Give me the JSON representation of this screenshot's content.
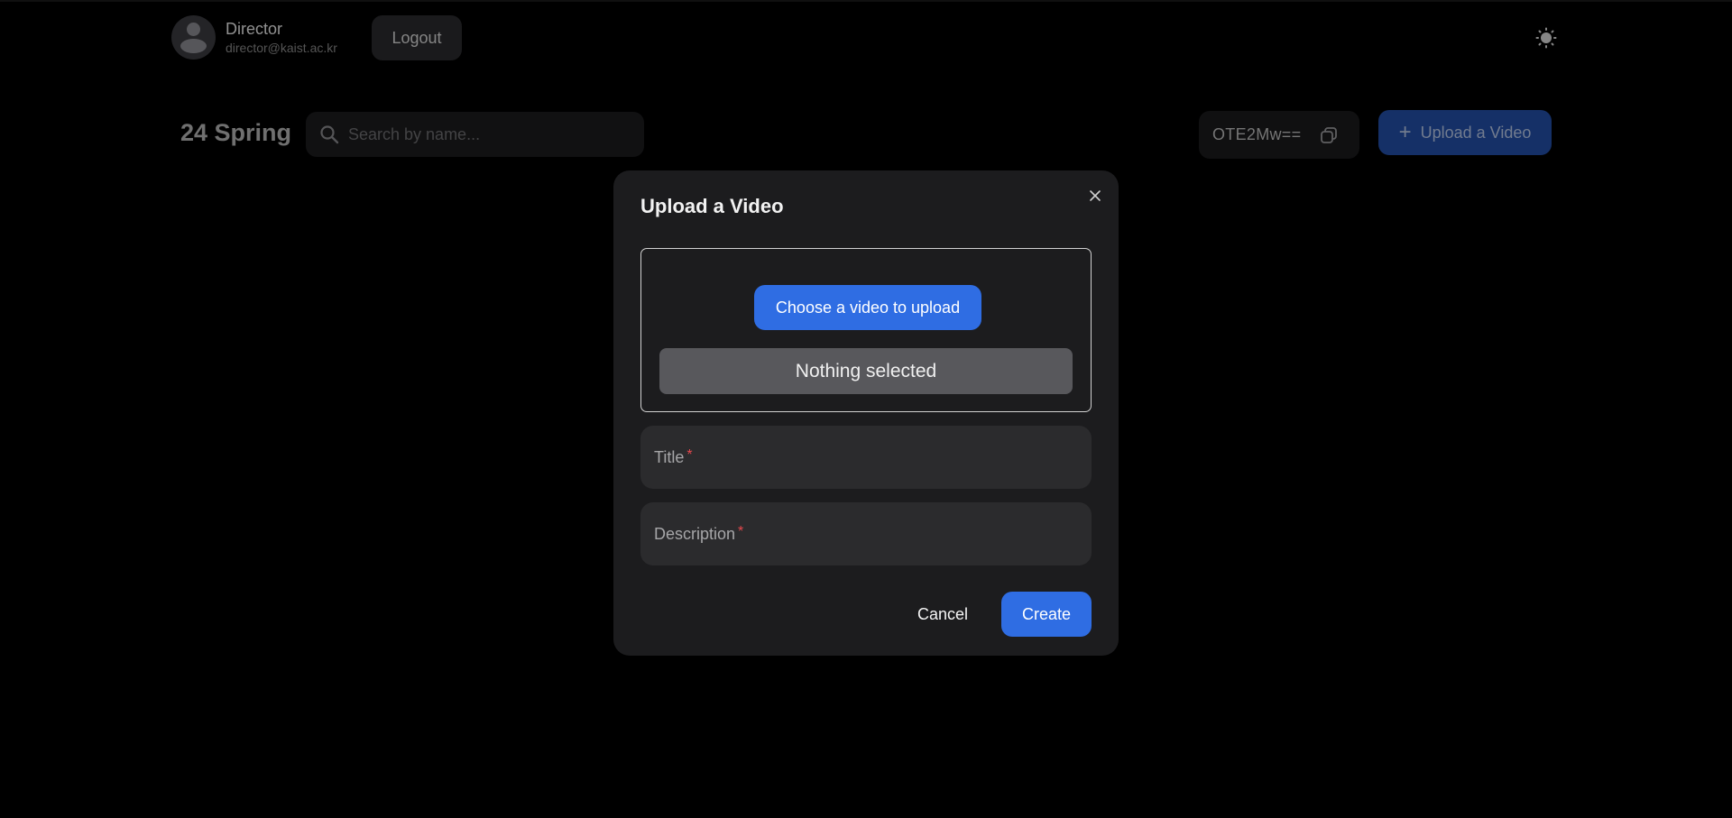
{
  "user": {
    "name": "Director",
    "email": "director@kaist.ac.kr",
    "logout_label": "Logout"
  },
  "header": {
    "semester": "24 Spring",
    "search_placeholder": "Search by name...",
    "code": "OTE2Mw==",
    "upload_label": "Upload a Video",
    "theme_icon": "sun-icon"
  },
  "modal": {
    "title": "Upload a Video",
    "choose_label": "Choose a video to upload",
    "selected_text": "Nothing selected",
    "title_field_label": "Title",
    "description_field_label": "Description",
    "required_marker": "*",
    "cancel_label": "Cancel",
    "create_label": "Create"
  },
  "colors": {
    "accent": "#2f6de3",
    "background": "#000000",
    "modal_bg": "#1c1c1e",
    "required": "#e5484d"
  }
}
